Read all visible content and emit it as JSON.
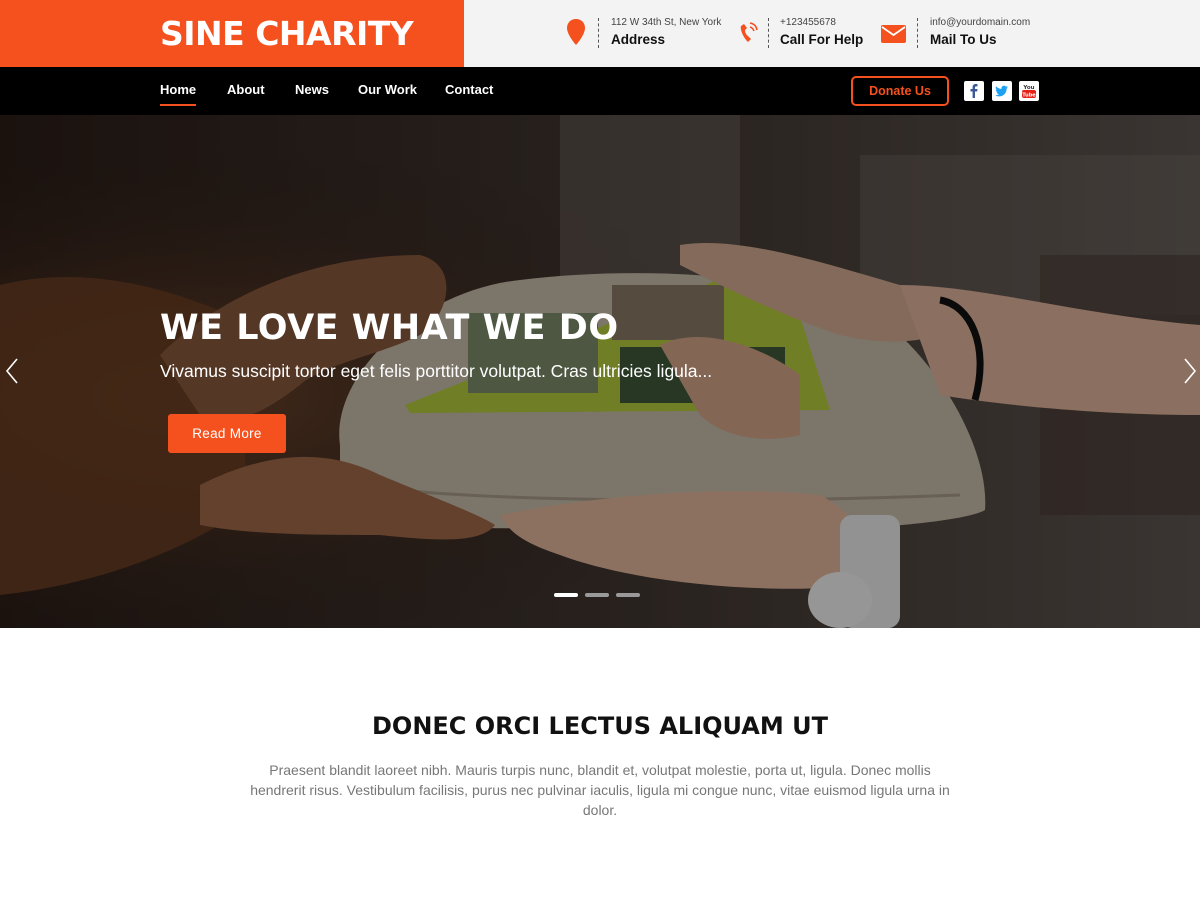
{
  "brand": {
    "name": "SINE CHARITY"
  },
  "contacts": {
    "address": {
      "small": "112 W 34th St, New York",
      "big": "Address",
      "icon": "map-pin-icon"
    },
    "phone": {
      "small": "+123455678",
      "big": "Call For Help",
      "icon": "phone-icon"
    },
    "mail": {
      "small": "info@yourdomain.com",
      "big": "Mail To Us",
      "icon": "envelope-icon"
    }
  },
  "nav": {
    "items": [
      {
        "label": "Home",
        "active": true
      },
      {
        "label": "About"
      },
      {
        "label": "News"
      },
      {
        "label": "Our Work"
      },
      {
        "label": "Contact"
      }
    ],
    "donate_label": "Donate Us",
    "social": [
      "facebook-icon",
      "twitter-icon",
      "youtube-icon"
    ]
  },
  "hero": {
    "title": "WE LOVE WHAT WE DO",
    "subtitle": "Vivamus suscipit tortor eget felis porttitor volutpat. Cras ultricies ligula...",
    "button_label": "Read More",
    "slides_total": 3,
    "active_slide": 1
  },
  "intro": {
    "title": "DONEC ORCI LECTUS ALIQUAM UT",
    "text": "Praesent blandit laoreet nibh. Mauris turpis nunc, blandit et, volutpat molestie, porta ut, ligula. Donec mollis hendrerit risus. Vestibulum facilisis, purus nec pulvinar iaculis, ligula mi congue nunc, vitae euismod ligula urna in dolor."
  },
  "colors": {
    "accent": "#f4511e",
    "nav_bg": "#000000",
    "topbar_bg": "#f3f3f3"
  }
}
